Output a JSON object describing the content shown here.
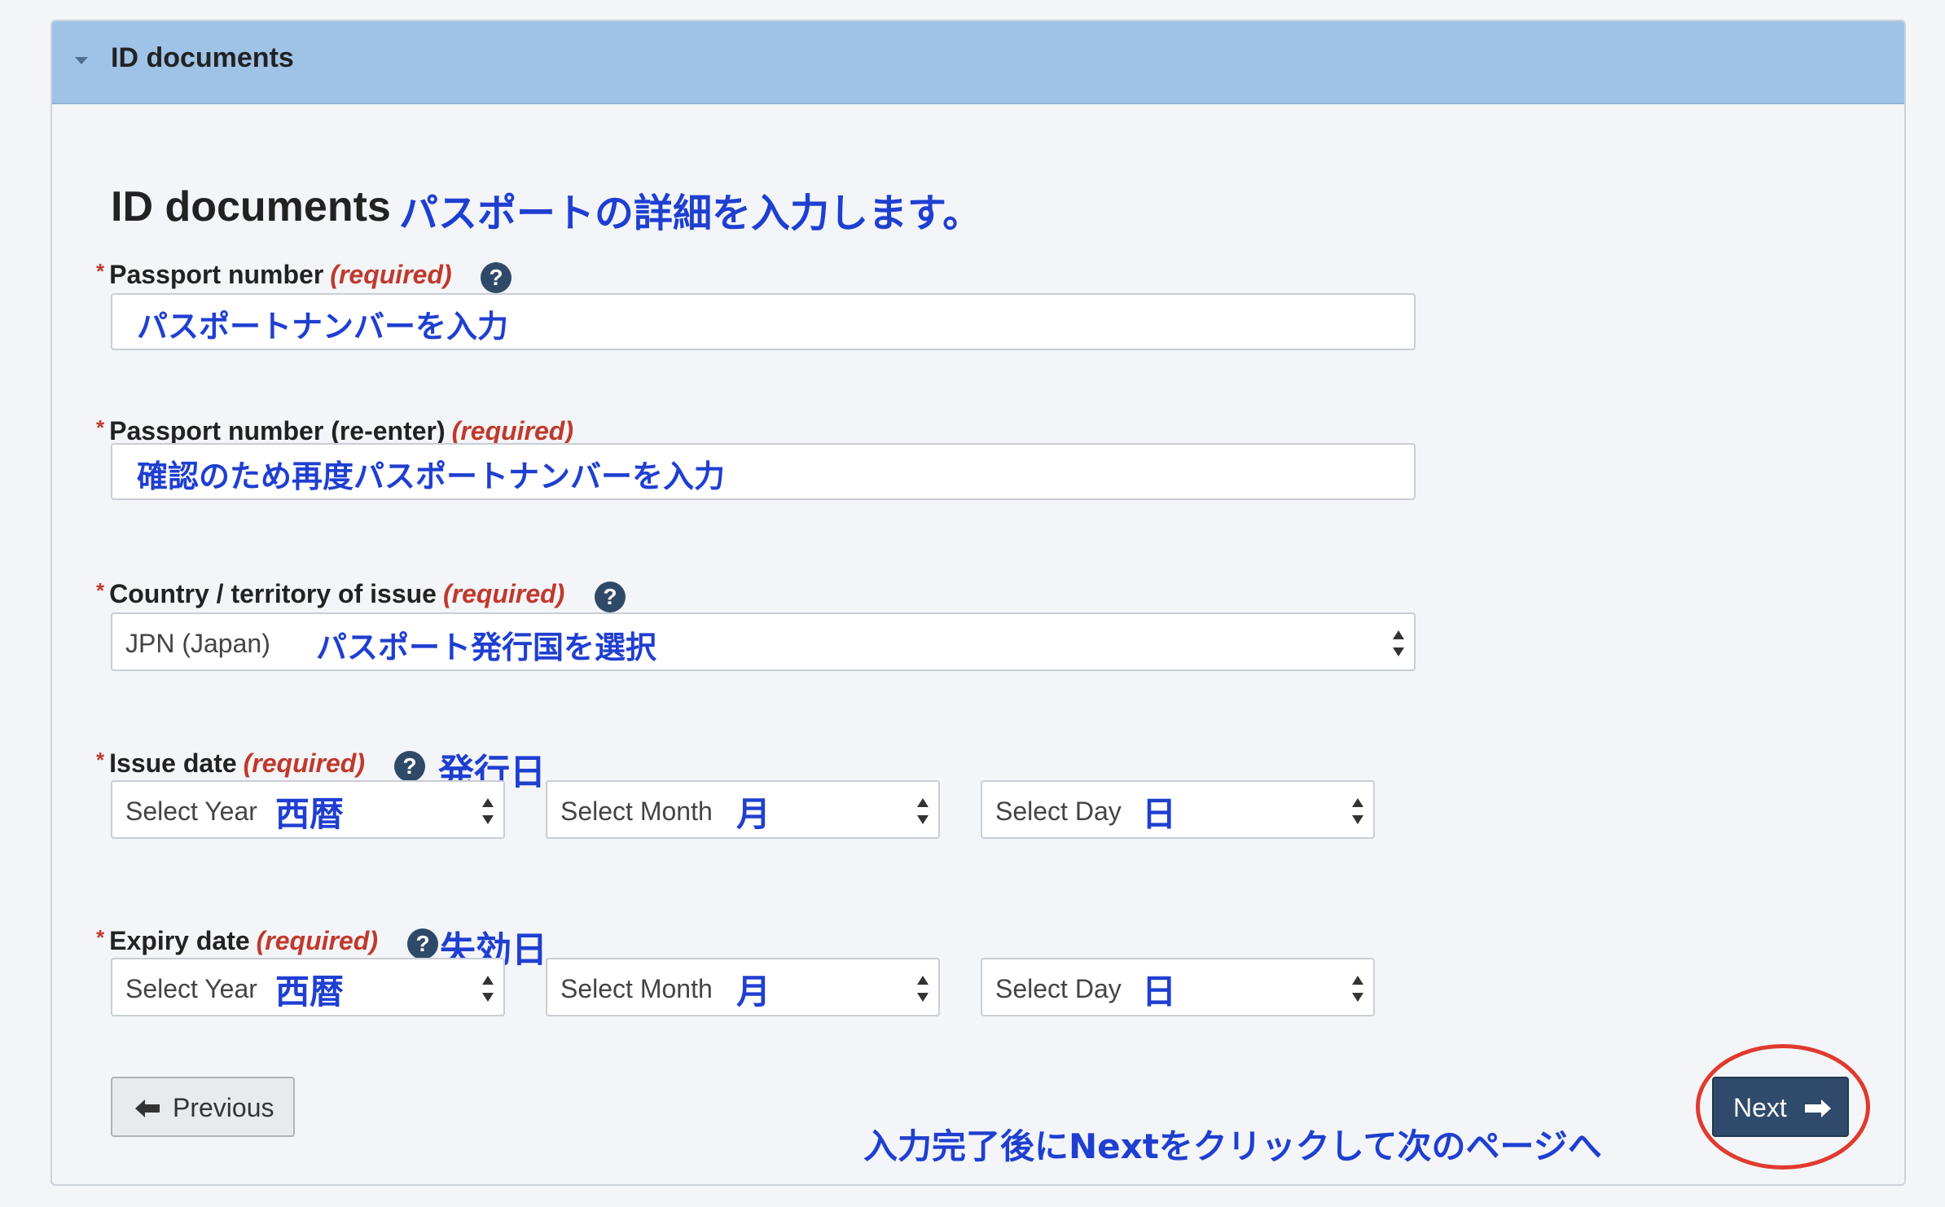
{
  "panel": {
    "title": "ID documents"
  },
  "section": {
    "title": "ID documents",
    "note": "パスポートの詳細を入力します。"
  },
  "fields": {
    "passport_number": {
      "label": "Passport number",
      "required": "(required)",
      "value": "パスポートナンバーを入力"
    },
    "passport_reenter": {
      "label": "Passport number (re-enter)",
      "required": "(required)",
      "value": "確認のため再度パスポートナンバーを入力"
    },
    "country": {
      "label": "Country / territory of issue",
      "required": "(required)",
      "selected": "JPN (Japan)",
      "note": "パスポート発行国を選択"
    },
    "issue_date": {
      "label": "Issue date",
      "required": "(required)",
      "note": "発行日",
      "year": {
        "placeholder": "Select Year",
        "note": "西暦"
      },
      "month": {
        "placeholder": "Select Month",
        "note": "月"
      },
      "day": {
        "placeholder": "Select Day",
        "note": "日"
      }
    },
    "expiry_date": {
      "label": "Expiry date",
      "required": "(required)",
      "note": "失効日",
      "year": {
        "placeholder": "Select Year",
        "note": "西暦"
      },
      "month": {
        "placeholder": "Select Month",
        "note": "月"
      },
      "day": {
        "placeholder": "Select Day",
        "note": "日"
      }
    }
  },
  "help_glyph": "?",
  "required_star": "*",
  "buttons": {
    "previous": "Previous",
    "next": "Next"
  },
  "footer_note": "入力完了後にNextをクリックして次のページへ",
  "colors": {
    "header_bg": "#9fc3e7",
    "annotation": "#1f3fd1",
    "required": "#c0392b",
    "next_button": "#2f4a6b",
    "highlight_circle": "#e03a2e"
  }
}
